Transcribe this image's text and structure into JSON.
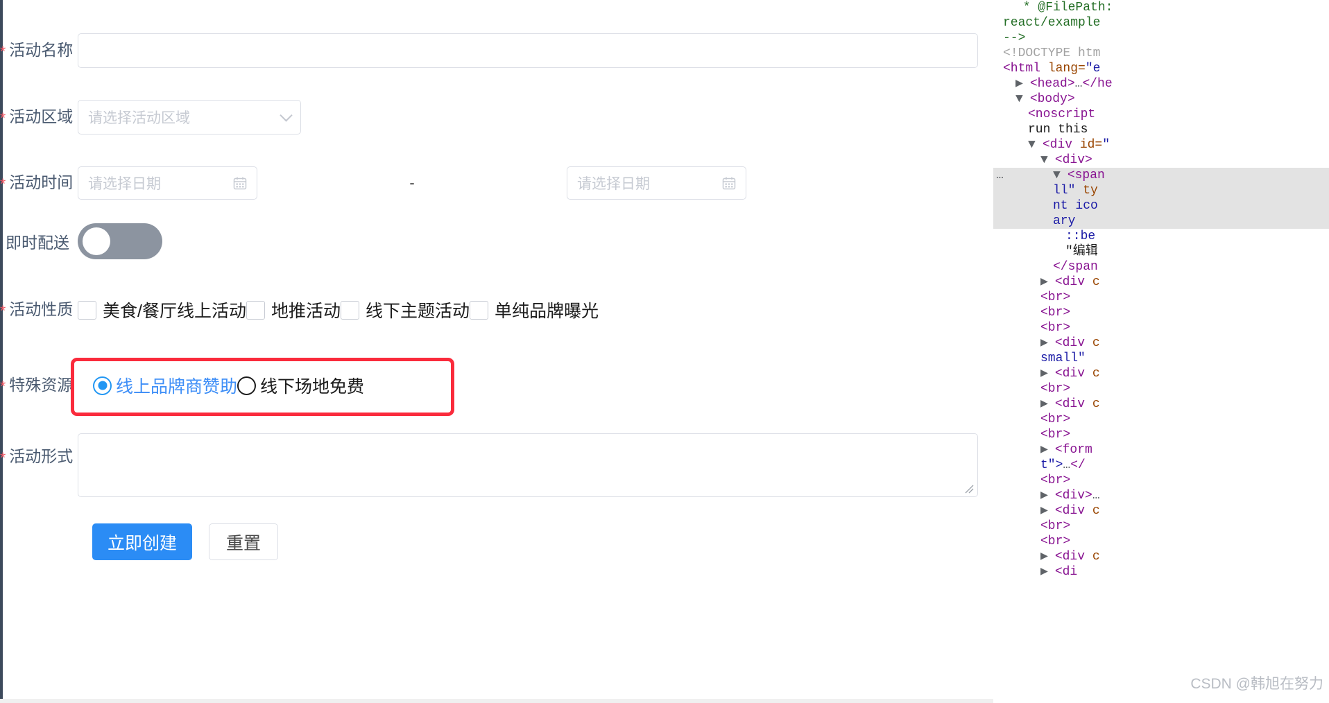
{
  "form": {
    "fields": [
      {
        "key": "activity_name",
        "label": "活动名称",
        "required_mark": "*",
        "type": "text",
        "value": "",
        "placeholder": ""
      },
      {
        "key": "activity_zone",
        "label": "活动区域",
        "required_mark": "*",
        "type": "select",
        "value": "",
        "placeholder": "请选择活动区域",
        "icon": "chevron-down-icon"
      },
      {
        "key": "activity_time",
        "label": "活动时间",
        "required_mark": "*",
        "type": "daterange",
        "separator": "-",
        "start_placeholder": "请选择日期",
        "end_placeholder": "请选择日期",
        "icon": "calendar-icon"
      },
      {
        "key": "instant_delivery",
        "label": "即时配送",
        "required_mark": "",
        "type": "switch",
        "checked": false
      },
      {
        "key": "activity_nature",
        "label": "活动性质",
        "required_mark": "*",
        "type": "checkbox-group",
        "options": [
          {
            "label": "美食/餐厅线上活动",
            "checked": false
          },
          {
            "label": "地推活动",
            "checked": false
          },
          {
            "label": "线下主题活动",
            "checked": false
          },
          {
            "label": "单纯品牌曝光",
            "checked": false
          }
        ]
      },
      {
        "key": "special_resource",
        "label": "特殊资源",
        "required_mark": "*",
        "type": "radio-group",
        "options": [
          {
            "label": "线上品牌商赞助",
            "checked": true
          },
          {
            "label": "线下场地免费",
            "checked": false
          }
        ]
      },
      {
        "key": "activity_form",
        "label": "活动形式",
        "required_mark": "*",
        "type": "textarea",
        "value": "",
        "placeholder": ""
      }
    ],
    "actions": {
      "submit_label": "立即创建",
      "reset_label": "重置"
    }
  },
  "colors": {
    "primary": "#2b8cf5",
    "required_star": "#f25663",
    "label_text": "#4a5a70",
    "border": "#dcdfe6",
    "placeholder": "#c6cad2",
    "switch_off": "#8c94a0",
    "radio_selected": "#3d8ef7",
    "annotation_red": "#fa2b3c"
  },
  "annotation": {
    "name": "red-highlight-rectangle",
    "target": "special_resource"
  },
  "devtools": {
    "lines": [
      {
        "indent": 1,
        "selected": false,
        "parts": [
          {
            "c": "cm",
            "t": " * @FilePath:"
          }
        ]
      },
      {
        "indent": 0,
        "selected": false,
        "parts": [
          {
            "c": "cm",
            "t": "react/example"
          }
        ]
      },
      {
        "indent": 0,
        "selected": false,
        "parts": [
          {
            "c": "cm",
            "t": "-->"
          }
        ]
      },
      {
        "indent": 0,
        "selected": false,
        "parts": [
          {
            "c": "dc",
            "t": "<!DOCTYPE htm"
          }
        ]
      },
      {
        "indent": 0,
        "selected": false,
        "parts": [
          {
            "c": "tw",
            "t": "<html "
          },
          {
            "c": "at",
            "t": "lang="
          },
          {
            "c": "av",
            "t": "\"e"
          }
        ]
      },
      {
        "indent": 1,
        "tri": "▶",
        "selected": false,
        "parts": [
          {
            "c": "tw",
            "t": "<head>"
          },
          {
            "c": "dots",
            "t": "…"
          },
          {
            "c": "tw",
            "t": "</he"
          }
        ]
      },
      {
        "indent": 1,
        "tri": "▼",
        "selected": false,
        "parts": [
          {
            "c": "tw",
            "t": "<body>"
          }
        ]
      },
      {
        "indent": 2,
        "selected": false,
        "parts": [
          {
            "c": "tw",
            "t": "<noscript"
          }
        ]
      },
      {
        "indent": 2,
        "selected": false,
        "parts": [
          {
            "c": "tx",
            "t": "run this "
          }
        ]
      },
      {
        "indent": 2,
        "tri": "▼",
        "selected": false,
        "parts": [
          {
            "c": "tw",
            "t": "<div "
          },
          {
            "c": "at",
            "t": "id="
          },
          {
            "c": "av",
            "t": "\""
          }
        ]
      },
      {
        "indent": 3,
        "tri": "▼",
        "selected": false,
        "parts": [
          {
            "c": "tw",
            "t": "<div>"
          }
        ]
      },
      {
        "indent": 4,
        "tri": "▼",
        "dots": "…",
        "selected": true,
        "parts": [
          {
            "c": "tw",
            "t": "<span "
          }
        ]
      },
      {
        "indent": 4,
        "selected": true,
        "parts": [
          {
            "c": "av",
            "t": "ll\" "
          },
          {
            "c": "at",
            "t": "ty"
          }
        ]
      },
      {
        "indent": 4,
        "selected": true,
        "parts": [
          {
            "c": "av",
            "t": "nt ico"
          }
        ]
      },
      {
        "indent": 4,
        "selected": true,
        "parts": [
          {
            "c": "av",
            "t": "ary"
          }
        ]
      },
      {
        "indent": 5,
        "selected": false,
        "parts": [
          {
            "c": "ps",
            "t": "::be"
          }
        ]
      },
      {
        "indent": 5,
        "selected": false,
        "parts": [
          {
            "c": "tx",
            "t": "\"编辑"
          }
        ]
      },
      {
        "indent": 4,
        "selected": false,
        "parts": [
          {
            "c": "tw",
            "t": "</span"
          }
        ]
      },
      {
        "indent": 3,
        "tri": "▶",
        "selected": false,
        "parts": [
          {
            "c": "tw",
            "t": "<div "
          },
          {
            "c": "at",
            "t": "c"
          }
        ]
      },
      {
        "indent": 3,
        "selected": false,
        "parts": [
          {
            "c": "tw",
            "t": "<br>"
          }
        ]
      },
      {
        "indent": 3,
        "selected": false,
        "parts": [
          {
            "c": "tw",
            "t": "<br>"
          }
        ]
      },
      {
        "indent": 3,
        "selected": false,
        "parts": [
          {
            "c": "tw",
            "t": "<br>"
          }
        ]
      },
      {
        "indent": 3,
        "tri": "▶",
        "selected": false,
        "parts": [
          {
            "c": "tw",
            "t": "<div "
          },
          {
            "c": "at",
            "t": "c"
          }
        ]
      },
      {
        "indent": 3,
        "selected": false,
        "parts": [
          {
            "c": "av",
            "t": "small\""
          }
        ]
      },
      {
        "indent": 3,
        "tri": "▶",
        "selected": false,
        "parts": [
          {
            "c": "tw",
            "t": "<div "
          },
          {
            "c": "at",
            "t": "c"
          }
        ]
      },
      {
        "indent": 3,
        "selected": false,
        "parts": [
          {
            "c": "tw",
            "t": "<br>"
          }
        ]
      },
      {
        "indent": 3,
        "tri": "▶",
        "selected": false,
        "parts": [
          {
            "c": "tw",
            "t": "<div "
          },
          {
            "c": "at",
            "t": "c"
          }
        ]
      },
      {
        "indent": 3,
        "selected": false,
        "parts": [
          {
            "c": "tw",
            "t": "<br>"
          }
        ]
      },
      {
        "indent": 3,
        "selected": false,
        "parts": [
          {
            "c": "tw",
            "t": "<br>"
          }
        ]
      },
      {
        "indent": 3,
        "tri": "▶",
        "selected": false,
        "parts": [
          {
            "c": "tw",
            "t": "<form"
          }
        ]
      },
      {
        "indent": 3,
        "selected": false,
        "parts": [
          {
            "c": "av",
            "t": "t\">"
          },
          {
            "c": "dots",
            "t": "…"
          },
          {
            "c": "tw",
            "t": "</"
          }
        ]
      },
      {
        "indent": 3,
        "selected": false,
        "parts": [
          {
            "c": "tw",
            "t": "<br>"
          }
        ]
      },
      {
        "indent": 3,
        "tri": "▶",
        "selected": false,
        "parts": [
          {
            "c": "tw",
            "t": "<div>"
          },
          {
            "c": "dots",
            "t": "…"
          }
        ]
      },
      {
        "indent": 3,
        "tri": "▶",
        "selected": false,
        "parts": [
          {
            "c": "tw",
            "t": "<div "
          },
          {
            "c": "at",
            "t": "c"
          }
        ]
      },
      {
        "indent": 3,
        "selected": false,
        "parts": [
          {
            "c": "tw",
            "t": "<br>"
          }
        ]
      },
      {
        "indent": 3,
        "selected": false,
        "parts": [
          {
            "c": "tw",
            "t": "<br>"
          }
        ]
      },
      {
        "indent": 3,
        "tri": "▶",
        "selected": false,
        "parts": [
          {
            "c": "tw",
            "t": "<div "
          },
          {
            "c": "at",
            "t": "c"
          }
        ]
      },
      {
        "indent": 3,
        "tri": "▶",
        "selected": false,
        "parts": [
          {
            "c": "tw",
            "t": "<di"
          }
        ]
      }
    ]
  },
  "watermark": "CSDN @韩旭在努力"
}
